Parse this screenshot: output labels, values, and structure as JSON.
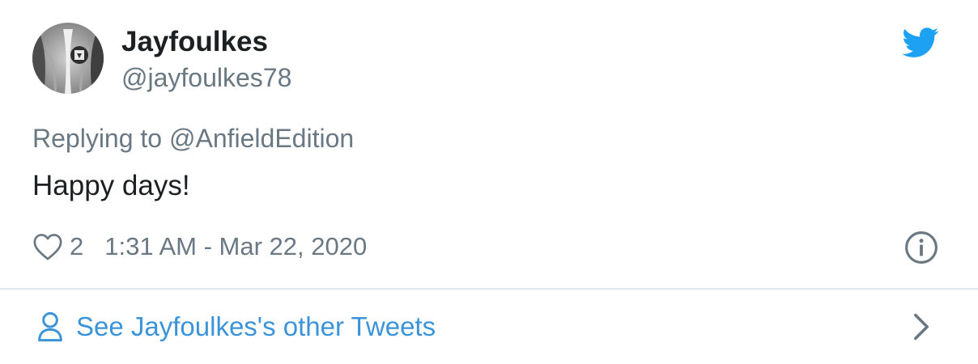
{
  "tweet": {
    "author_name": "Jayfoulkes",
    "author_handle": "@jayfoulkes78",
    "reply_context": "Replying to @AnfieldEdition",
    "text": "Happy days!",
    "like_count": "2",
    "timestamp": "1:31 AM - Mar 22, 2020"
  },
  "footer": {
    "link_text": "See Jayfoulkes's other Tweets"
  },
  "icons": {
    "brand": "twitter-bird-icon",
    "like": "heart-icon",
    "info": "info-icon",
    "person": "person-icon",
    "chevron": "chevron-right-icon"
  },
  "colors": {
    "brand_blue": "#1da1f2",
    "link_blue": "#3b94d9",
    "secondary_text": "#697882",
    "primary_text": "#1c2022",
    "divider": "#e1e8ed"
  }
}
